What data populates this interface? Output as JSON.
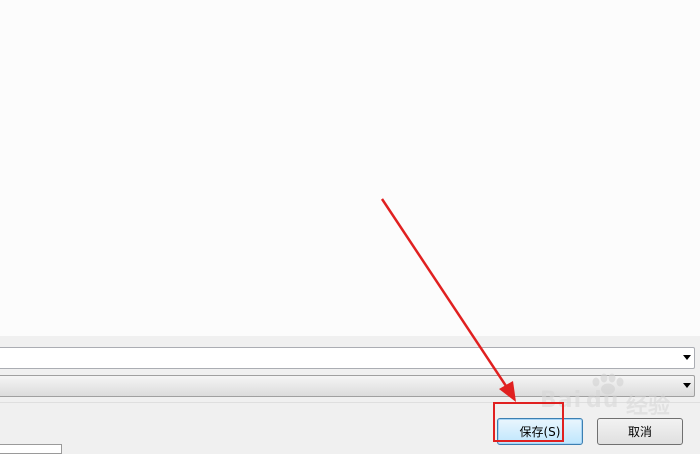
{
  "dialog": {
    "filename_value": "",
    "filetype_value": "",
    "save_button_label": "保存(S)",
    "cancel_button_label": "取消"
  },
  "watermark": {
    "brand_latin": "Bai",
    "brand_du": "du",
    "brand_cn": "经验"
  },
  "colors": {
    "annotation_red": "#e02020",
    "save_button_border": "#3c7fb1"
  }
}
